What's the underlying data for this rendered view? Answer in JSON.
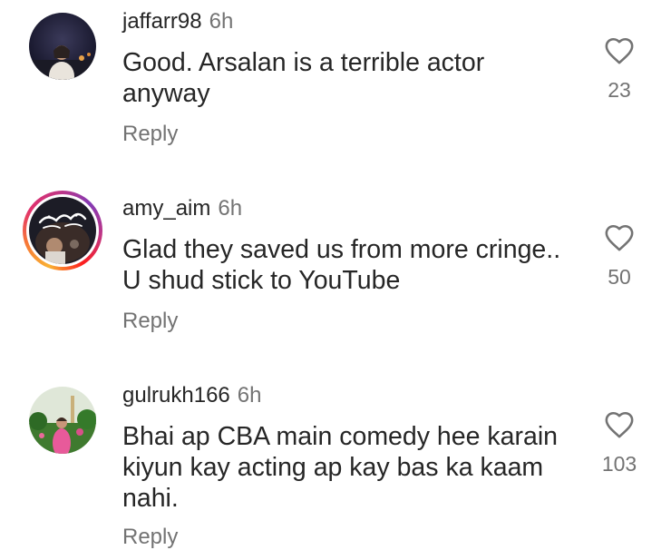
{
  "comments": [
    {
      "username": "jaffarr98",
      "time": "6h",
      "line1": "Good. Arsalan is a terrible actor",
      "line2": "anyway",
      "line3": "",
      "reply": "Reply",
      "likes": "23",
      "avatar_story_ring": false
    },
    {
      "username": "amy_aim",
      "time": "6h",
      "line1": "Glad they saved us from more cringe..",
      "line2": "U shud stick to YouTube",
      "line3": "",
      "reply": "Reply",
      "likes": "50",
      "avatar_story_ring": true
    },
    {
      "username": "gulrukh166",
      "time": "6h",
      "line1": "Bhai ap CBA main comedy hee karain",
      "line2": "kiyun kay acting ap kay bas ka kaam",
      "line3": "nahi.",
      "reply": "Reply",
      "likes": "103",
      "avatar_story_ring": false
    }
  ],
  "icons": {
    "like": "heart-outline-icon"
  },
  "colors": {
    "primary_text": "#262626",
    "secondary_text": "#737373",
    "background": "#ffffff"
  }
}
